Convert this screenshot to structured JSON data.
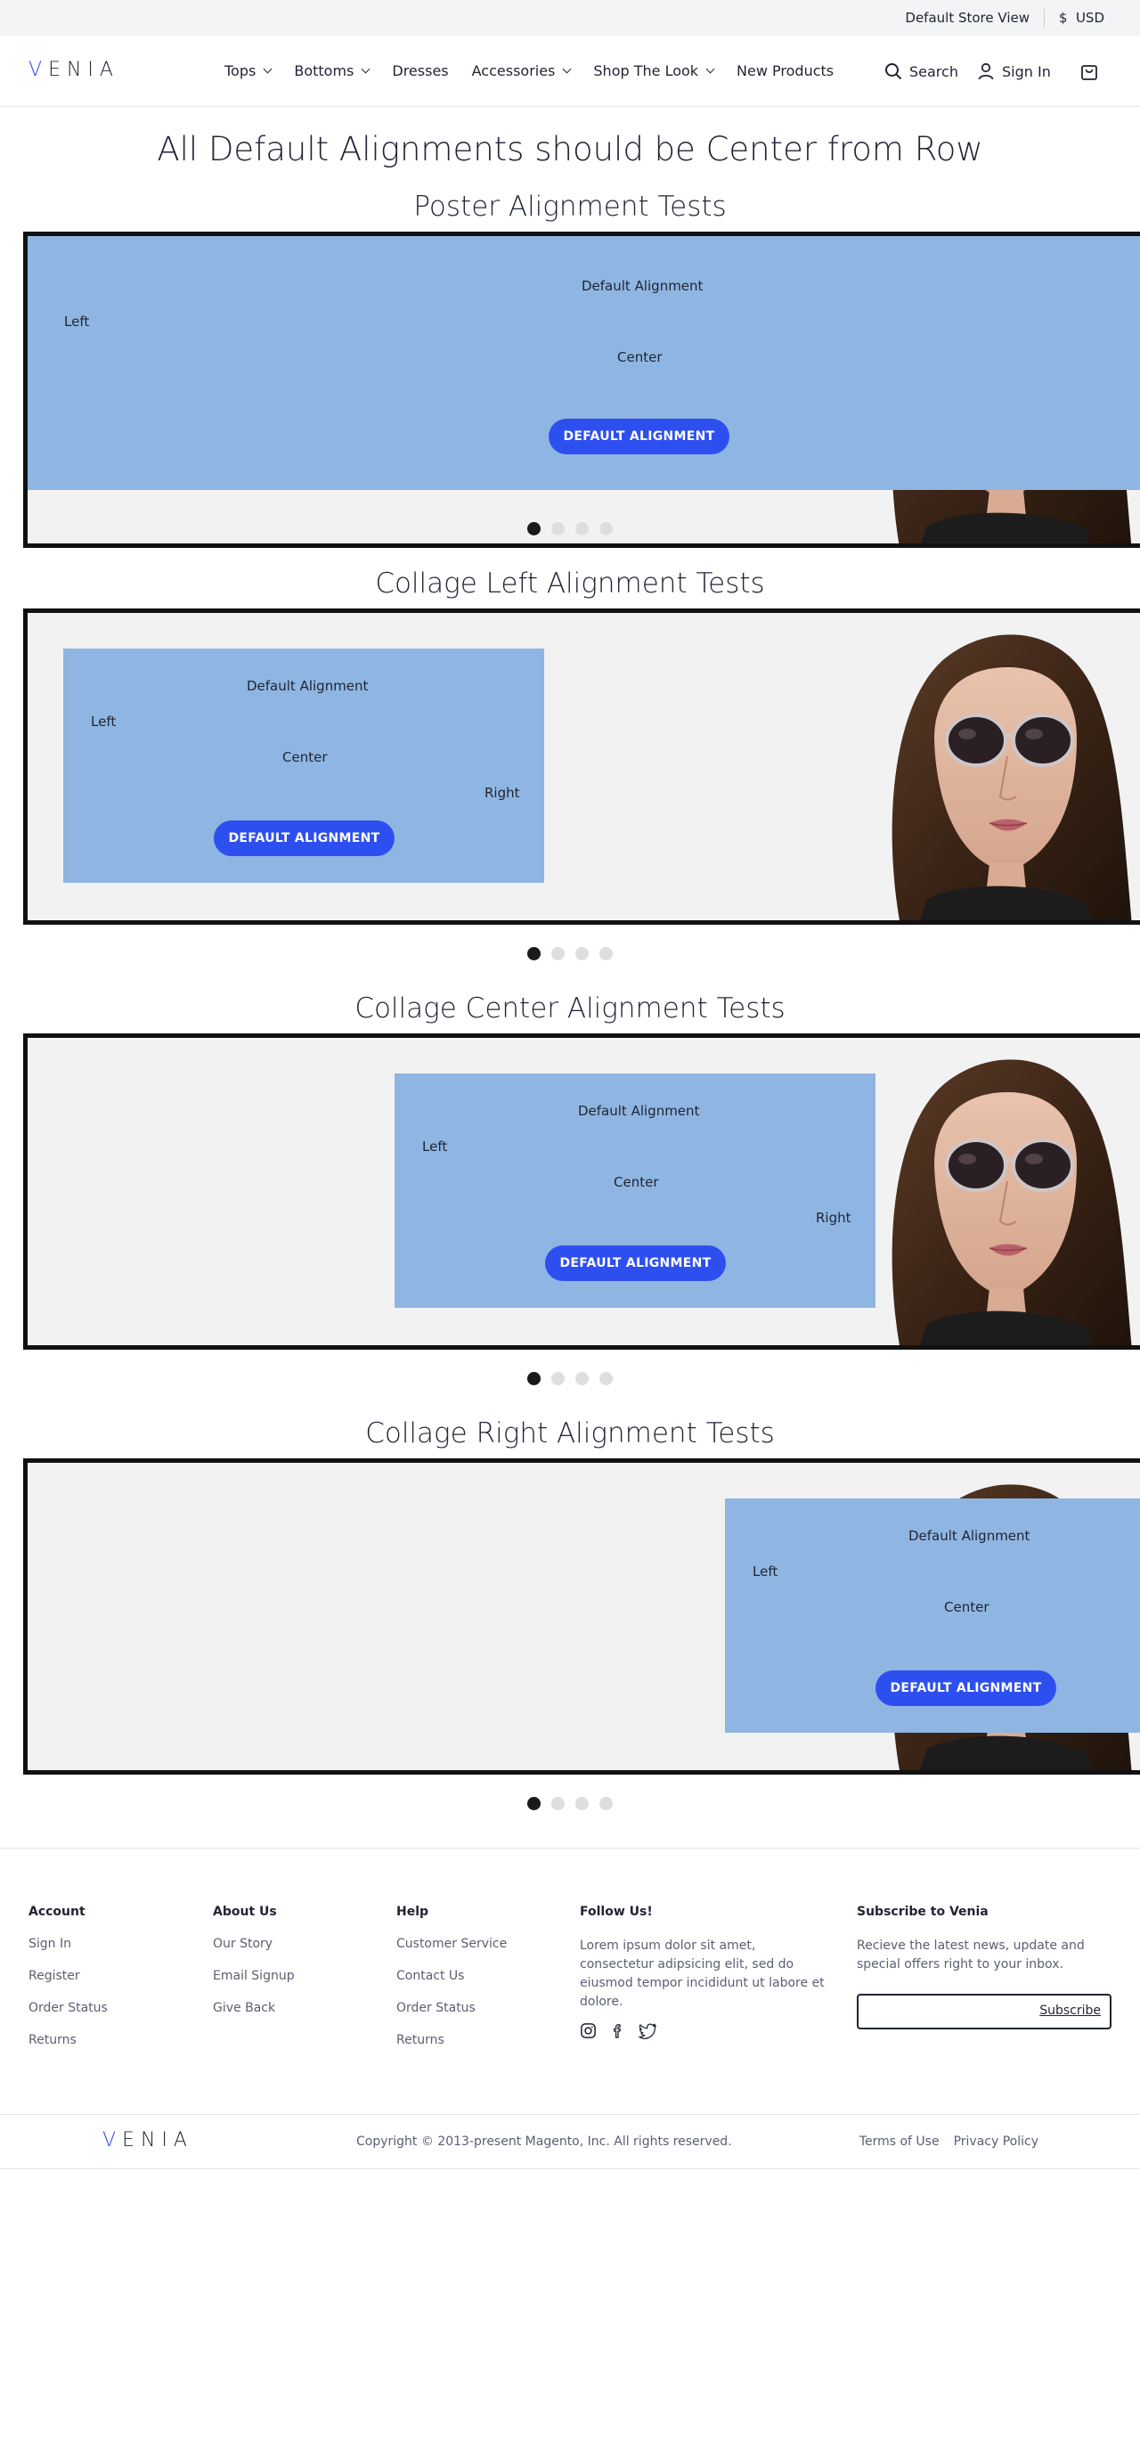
{
  "topbar": {
    "store_view": "Default Store View",
    "currency": "USD"
  },
  "header": {
    "logo": "VENIA",
    "nav": [
      {
        "label": "Tops",
        "has_dropdown": true
      },
      {
        "label": "Bottoms",
        "has_dropdown": true
      },
      {
        "label": "Dresses",
        "has_dropdown": false
      },
      {
        "label": "Accessories",
        "has_dropdown": true
      },
      {
        "label": "Shop The Look",
        "has_dropdown": true
      },
      {
        "label": "New Products",
        "has_dropdown": false
      }
    ],
    "search_label": "Search",
    "signin_label": "Sign In",
    "icons": [
      "search-icon",
      "user-icon",
      "shopping-bag-icon"
    ]
  },
  "main": {
    "title": "All Default Alignments should be Center from Row",
    "sections": [
      {
        "title": "Poster Alignment Tests",
        "default_text": "Default Alignment",
        "left_text": "Left",
        "center_text": "Center",
        "button": "DEFAULT ALIGNMENT",
        "slides": 4,
        "active_slide": 1
      },
      {
        "title": "Collage Left Alignment Tests",
        "default_text": "Default Alignment",
        "left_text": "Left",
        "center_text": "Center",
        "right_text": "Right",
        "button": "DEFAULT ALIGNMENT",
        "slides": 4,
        "active_slide": 1
      },
      {
        "title": "Collage Center Alignment Tests",
        "default_text": "Default Alignment",
        "left_text": "Left",
        "center_text": "Center",
        "right_text": "Right",
        "button": "DEFAULT ALIGNMENT",
        "slides": 4,
        "active_slide": 1
      },
      {
        "title": "Collage Right Alignment Tests",
        "default_text": "Default Alignment",
        "left_text": "Left",
        "center_text": "Center",
        "button": "DEFAULT ALIGNMENT",
        "slides": 4,
        "active_slide": 1
      }
    ]
  },
  "footer": {
    "account": {
      "heading": "Account",
      "links": [
        "Sign In",
        "Register",
        "Order Status",
        "Returns"
      ]
    },
    "about": {
      "heading": "About Us",
      "links": [
        "Our Story",
        "Email Signup",
        "Give Back"
      ]
    },
    "help": {
      "heading": "Help",
      "links": [
        "Customer Service",
        "Contact Us",
        "Order Status",
        "Returns"
      ]
    },
    "follow": {
      "heading": "Follow Us!",
      "text": "Lorem ipsum dolor sit amet, consectetur adipsicing elit, sed do eiusmod tempor incididunt ut labore et dolore.",
      "icons": [
        "instagram-icon",
        "facebook-icon",
        "twitter-icon"
      ]
    },
    "subscribe": {
      "heading": "Subscribe to Venia",
      "text": "Recieve the latest news, update and special offers right to your inbox.",
      "button": "Subscribe"
    },
    "logo": "VENIA",
    "copyright": "Copyright © 2013-present Magento, Inc. All rights reserved.",
    "terms": "Terms of Use",
    "privacy": "Privacy Policy"
  },
  "colors": {
    "accent": "#2e4ff0",
    "panel": "#8fb6e2",
    "frame_bg": "#f2f2f2"
  }
}
